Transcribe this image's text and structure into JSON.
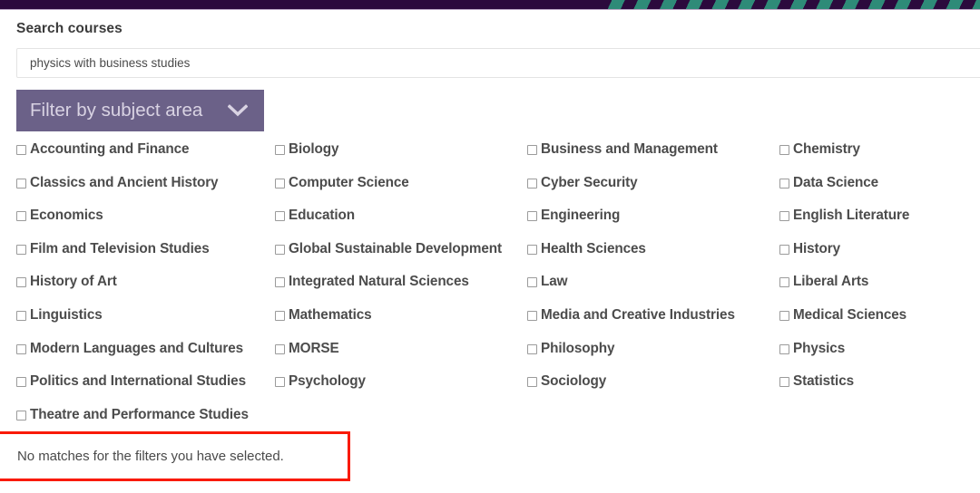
{
  "brand": {
    "bar_color": "#2b0a3d",
    "stripe_color": "#2e8b78",
    "accent_purple": "#6b6188",
    "alert_border_color": "#f91a05"
  },
  "search": {
    "label": "Search courses",
    "value": "physics with business studies",
    "placeholder": "Search courses"
  },
  "filter": {
    "label": "Filter by subject area",
    "icon": "chevron-down-icon"
  },
  "subjects": {
    "columns": [
      [
        "Accounting and Finance",
        "Classics and Ancient History",
        "Economics",
        "Film and Television Studies",
        "History of Art",
        "Linguistics",
        "Modern Languages and Cultures",
        "Politics and International Studies",
        "Theatre and Performance Studies"
      ],
      [
        "Biology",
        "Computer Science",
        "Education",
        "Global Sustainable Development",
        "Integrated Natural Sciences",
        "Mathematics",
        "MORSE",
        "Psychology"
      ],
      [
        "Business and Management",
        "Cyber Security",
        "Engineering",
        "Health Sciences",
        "Law",
        "Media and Creative Industries",
        "Philosophy",
        "Sociology"
      ],
      [
        "Chemistry",
        "Data Science",
        "English Literature",
        "History",
        "Liberal Arts",
        "Medical Sciences",
        "Physics",
        "Statistics"
      ]
    ]
  },
  "results": {
    "no_matches_message": "No matches for the filters you have selected."
  }
}
